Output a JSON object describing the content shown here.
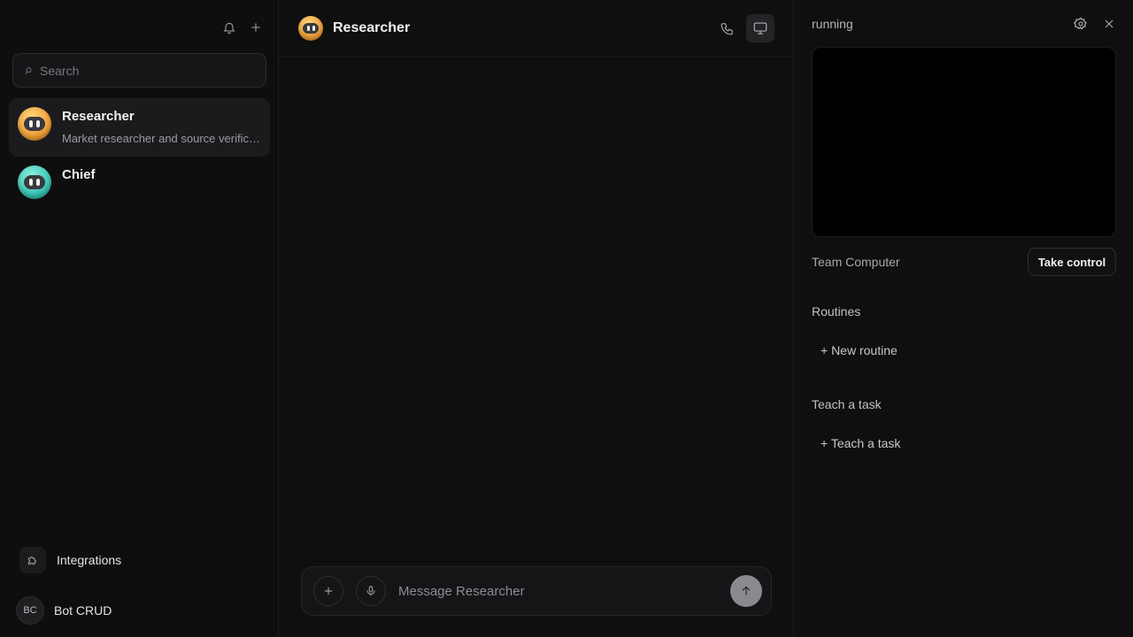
{
  "sidebar": {
    "search_placeholder": "Search",
    "agents": [
      {
        "name": "Researcher",
        "description": "Market researcher and source verification",
        "color": "#f0a23a",
        "active": true
      },
      {
        "name": "Chief",
        "description": "",
        "color": "#3cc6b4",
        "active": false
      }
    ],
    "integrations_label": "Integrations",
    "user": {
      "initials": "BC",
      "name": "Bot CRUD"
    }
  },
  "chat": {
    "title": "Researcher",
    "composer_placeholder": "Message Researcher"
  },
  "panel": {
    "status": "running",
    "computer_label": "Team Computer",
    "take_control_label": "Take control",
    "routines_title": "Routines",
    "new_routine_label": "+ New routine",
    "teach_title": "Teach a task",
    "teach_link_label": "+ Teach a task"
  }
}
